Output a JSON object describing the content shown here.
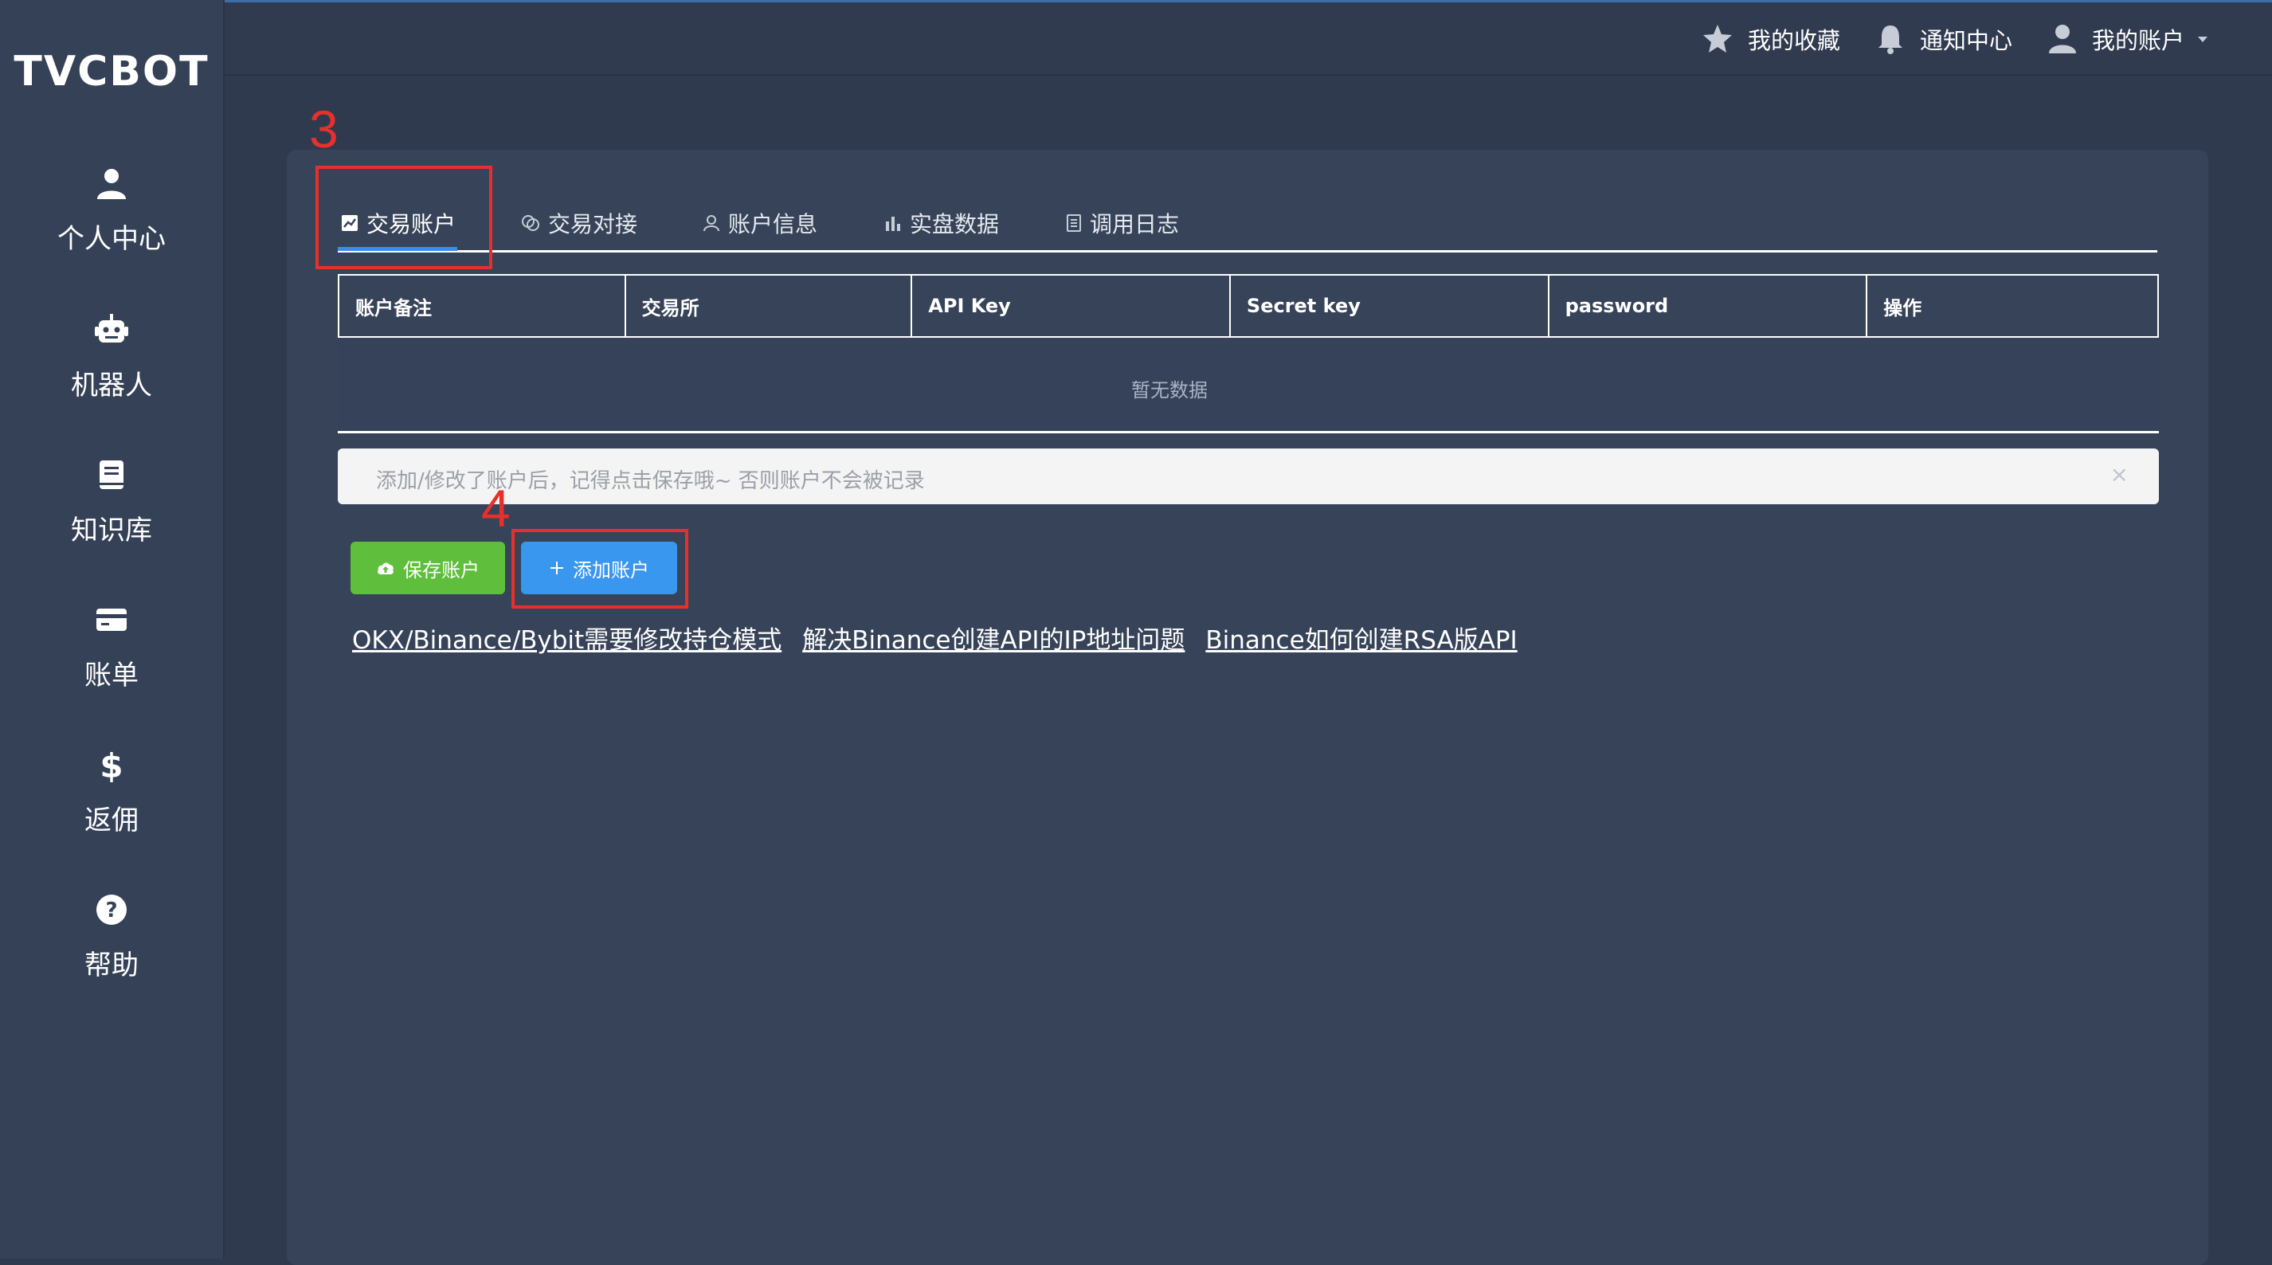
{
  "brand": {
    "logo": "TVCBOT"
  },
  "sidebar": {
    "items": [
      {
        "label": "个人中心",
        "icon": "user-icon"
      },
      {
        "label": "机器人",
        "icon": "robot-icon"
      },
      {
        "label": "知识库",
        "icon": "book-icon"
      },
      {
        "label": "账单",
        "icon": "credit-card-icon"
      },
      {
        "label": "返佣",
        "icon": "dollar-icon"
      },
      {
        "label": "帮助",
        "icon": "question-icon"
      }
    ]
  },
  "topbar": {
    "favorites": "我的收藏",
    "notifications": "通知中心",
    "account": "我的账户"
  },
  "annotations": {
    "step_tab": "3",
    "step_add": "4",
    "color": "#e8302a"
  },
  "tabs": [
    {
      "label": "交易账户",
      "icon": "chart-icon",
      "active": true
    },
    {
      "label": "交易对接",
      "icon": "link-icon"
    },
    {
      "label": "账户信息",
      "icon": "user-outline-icon"
    },
    {
      "label": "实盘数据",
      "icon": "bar-chart-icon"
    },
    {
      "label": "调用日志",
      "icon": "document-icon"
    }
  ],
  "table": {
    "columns": [
      "账户备注",
      "交易所",
      "API Key",
      "Secret key",
      "password",
      "操作"
    ],
    "empty_text": "暂无数据"
  },
  "alert": {
    "text": "添加/修改了账户后，记得点击保存哦~ 否则账户不会被记录",
    "close": "×"
  },
  "buttons": {
    "save": "保存账户",
    "add": "添加账户"
  },
  "help_links": [
    "OKX/Binance/Bybit需要修改持仓模式",
    "解决Binance创建API的IP地址问题",
    "Binance如何创建RSA版API"
  ],
  "colors": {
    "accent": "#3a8ee6",
    "save": "#5fbf3c",
    "add": "#3a97f0",
    "background": "#2f3a4f"
  }
}
